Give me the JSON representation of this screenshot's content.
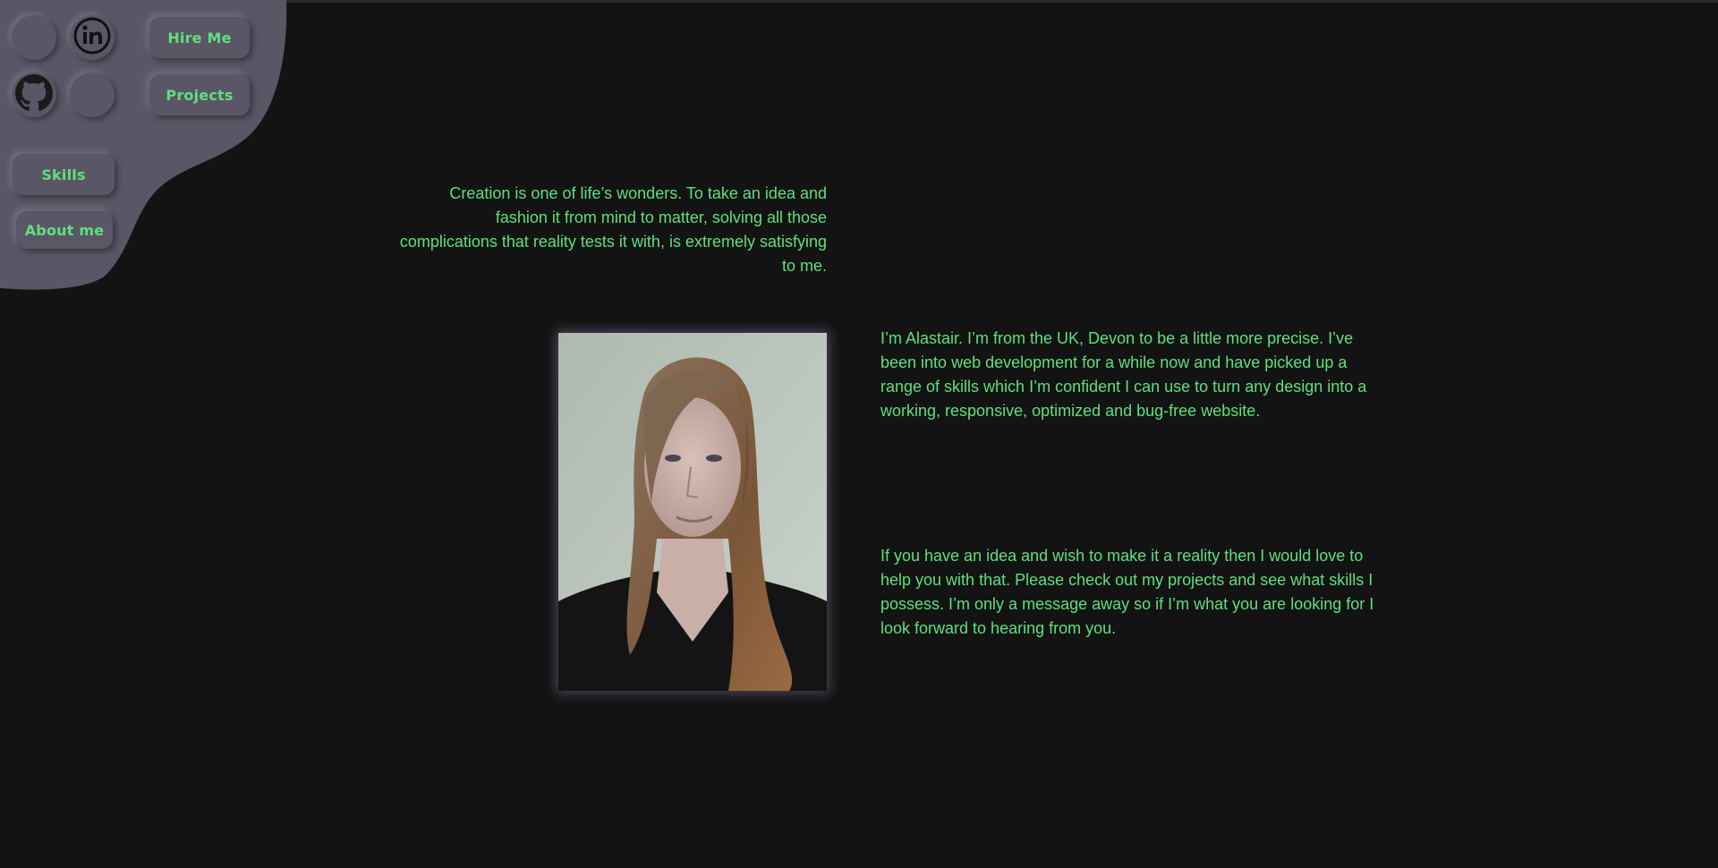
{
  "nav": {
    "hire_label": "Hire Me",
    "projects_label": "Projects",
    "skills_label": "Skills",
    "about_label": "About me",
    "icons": [
      "social-icon-blank",
      "linkedin-icon",
      "github-icon",
      "social-icon-blank"
    ]
  },
  "content": {
    "quote": "Creation is one of life’s wonders. To take an idea and fashion it from mind to matter, solving all those complications that reality tests it with, is extremely satisfying to me.",
    "about_p1": "I’m Alastair. I’m from the UK, Devon to be a little more precise. I’ve been into web development for a while now and have picked up a range of skills which I’m confident I can use to turn any design into a working, responsive, optimized and bug-free website.",
    "about_p2": "If you have an idea and wish to make it a reality then I would love to help you with that. Please check out my projects and see what skills I possess. I’m only a message away so if I’m what you are looking for I look forward to hearing from you."
  },
  "colors": {
    "background": "#131313",
    "nav_panel": "#5b5666",
    "accent_text": "#5ee07a"
  }
}
